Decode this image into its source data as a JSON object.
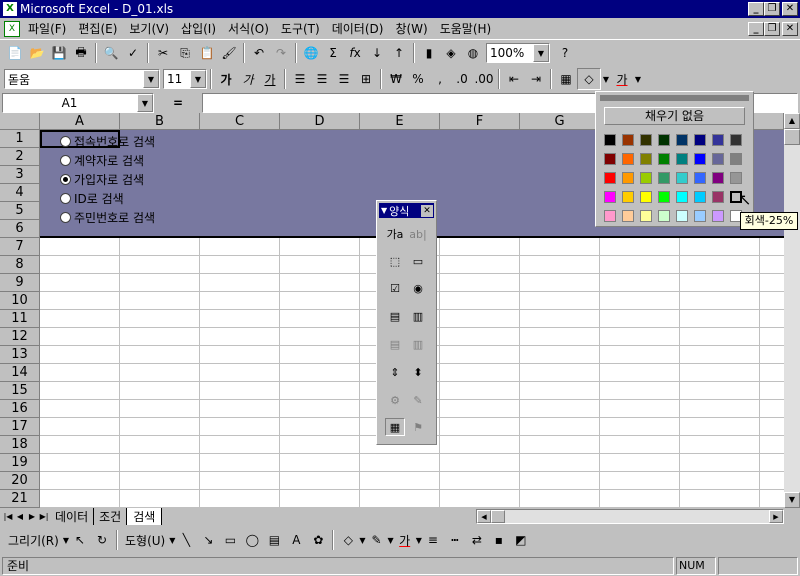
{
  "window": {
    "title": "Microsoft Excel - D_01.xls",
    "app_icon": "X"
  },
  "menu": [
    "파일(F)",
    "편집(E)",
    "보기(V)",
    "삽입(I)",
    "서식(O)",
    "도구(T)",
    "데이터(D)",
    "창(W)",
    "도움말(H)"
  ],
  "toolbar": {
    "zoom": "100%"
  },
  "format": {
    "font": "돋움",
    "size": "11",
    "bold": "가",
    "italic": "가",
    "underline": "가",
    "currency": "₩",
    "percent": "%",
    "font_color_glyph": "가"
  },
  "formula": {
    "namebox": "A1",
    "equals": "="
  },
  "columns": [
    "A",
    "B",
    "C",
    "D",
    "E",
    "F",
    "G",
    "H",
    "I"
  ],
  "rows": [
    "1",
    "2",
    "3",
    "4",
    "5",
    "6",
    "7",
    "8",
    "9",
    "10",
    "11",
    "12",
    "13",
    "14",
    "15",
    "16",
    "17",
    "18",
    "19",
    "20",
    "21"
  ],
  "options": [
    {
      "label": "접속번호로 검색",
      "checked": false
    },
    {
      "label": "계약자로 검색",
      "checked": false
    },
    {
      "label": "가입자로 검색",
      "checked": true
    },
    {
      "label": "ID로 검색",
      "checked": false
    },
    {
      "label": "주민번호로 검색",
      "checked": false
    }
  ],
  "fill_palette": {
    "no_fill": "채우기 없음",
    "tooltip": "회색-25%",
    "colors": [
      [
        "#000000",
        "#993300",
        "#333300",
        "#003300",
        "#003366",
        "#000080",
        "#333399",
        "#333333"
      ],
      [
        "#800000",
        "#FF6600",
        "#808000",
        "#008000",
        "#008080",
        "#0000FF",
        "#666699",
        "#808080"
      ],
      [
        "#FF0000",
        "#FF9900",
        "#99CC00",
        "#339966",
        "#33CCCC",
        "#3366FF",
        "#800080",
        "#969696"
      ],
      [
        "#FF00FF",
        "#FFCC00",
        "#FFFF00",
        "#00FF00",
        "#00FFFF",
        "#00CCFF",
        "#993366",
        "#C0C0C0"
      ],
      [
        "#FF99CC",
        "#FFCC99",
        "#FFFF99",
        "#CCFFCC",
        "#CCFFFF",
        "#99CCFF",
        "#CC99FF",
        "#FFFFFF"
      ]
    ]
  },
  "forms_toolbar": {
    "title": "양식"
  },
  "sheets": [
    "데이터",
    "조건",
    "검색"
  ],
  "drawing": {
    "draw_label": "그리기(R)",
    "autoshape_label": "도형(U)"
  },
  "status": {
    "left": "준비",
    "num": "NUM"
  },
  "colors": {
    "selection_fill": "#7878a0",
    "title_bar": "#000080"
  }
}
